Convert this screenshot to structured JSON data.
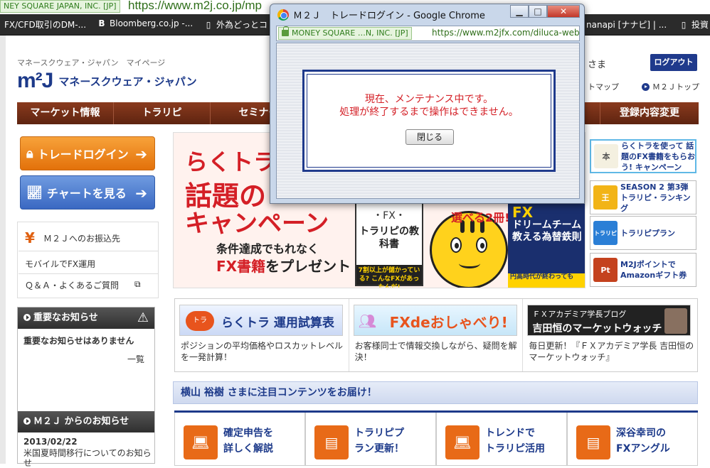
{
  "browser": {
    "ssl_badge": "NEY SQUARE JAPAN, INC. [JP]",
    "url": "https://www.m2j.co.jp/mp",
    "bookmarks": [
      {
        "icon": "",
        "label": "FX/CFD取引のDM-..."
      },
      {
        "icon": "B",
        "label": "Bloomberg.co.jp -..."
      },
      {
        "icon": "",
        "label": "外為どっとコ"
      },
      {
        "icon": "",
        "label": "nanapi [ナナピ] | ..."
      },
      {
        "icon": "",
        "label": "投資"
      }
    ]
  },
  "site": {
    "subtitle": "マネースクウェア・ジャパン　マイページ",
    "logo_mark": "m²J",
    "logo_name": "マネースクウェア・ジャパン",
    "user_suffix": "さま",
    "logout_label": "ログアウト",
    "sitemap_label": "トマップ",
    "top_label": "Ｍ２Ｊトップ",
    "nav": [
      "マーケット情報",
      "トラリピ",
      "セミナー",
      "登録内容変更"
    ]
  },
  "left": {
    "login_button": "トレードログイン",
    "chart_button": "チャートを見る",
    "links": [
      "Ｍ２Ｊへのお振込先",
      "モバイルでFX運用",
      "Ｑ＆Ａ・よくあるご質問"
    ],
    "important_heading": "重要なお知らせ",
    "important_text": "重要なお知らせはありません",
    "important_more": "一覧",
    "m2j_heading": "Ｍ２Ｊ からのお知らせ",
    "m2j_date": "2013/02/22",
    "m2j_text": "米国夏時間移行についてのお知らせ"
  },
  "banner": {
    "line1": "らくトラを",
    "line2": "話題の",
    "line3": "キャンペーン",
    "sub1": "条件達成でもれなく",
    "sub2_accent": "FX書籍",
    "sub2_rest": "をプレゼント",
    "select_text": "選べる2冊!",
    "book1_label": "・FX・",
    "book1_title": "トラリピの教科書",
    "book1_band": "7割以上が儲かっている? こんなFXがあったんだ!",
    "book2_fx": "FX",
    "book2_title": "ドリームチーム教える為替鉄則",
    "book2_band": "円高時代が終わっても"
  },
  "right_boxes": [
    {
      "icon": "本",
      "text": "らくトラを使って 話題のFX書籍をもらおう! キャンペーン",
      "color": "#ffffff"
    },
    {
      "icon": "王",
      "text": "SEASON 2 第3弾 トラリピ・ランキング",
      "color": "#f2b417"
    },
    {
      "icon": "トラリピ",
      "text": "トラリピプラン",
      "color": "#2b7fd6"
    },
    {
      "icon": "Pt",
      "text": "M2Jポイントで Amazonギフト券",
      "color": "#c4421e"
    }
  ],
  "features": [
    {
      "banner": "らくトラ 運用試算表",
      "text": "ポジションの平均価格やロスカットレベルを一発計算！"
    },
    {
      "banner": "FXdeおしゃべり!",
      "text": "お客様同士で情報交換しながら、疑問を解決！"
    },
    {
      "banner_top": "ＦＸアカデミア学長ブログ",
      "banner": "吉田恒のマーケットウォッチ",
      "text": "毎日更新！『ＦＸアカデミア学長 吉田恒のマーケットウォッチ』"
    }
  ],
  "attention": "横山 裕樹 さまに注目コンテンツをお届け！",
  "cards": [
    {
      "line1": "確定申告を",
      "line2": "詳しく解説"
    },
    {
      "line1": "トラリピプ",
      "line2": "ラン更新！"
    },
    {
      "line1": "トレンドで",
      "line2": "トラリピ活用"
    },
    {
      "line1": "深谷幸司の",
      "line2": "FXアングル"
    }
  ],
  "popup": {
    "title": "Ｍ２Ｊ　トレードログイン - Google Chrome",
    "ssl_badge": "MONEY SQUARE …N, INC. [JP]",
    "url": "https://www.m2jfx.com/diluca-web",
    "message1": "現在、メンテナンス中です。",
    "message2": "処理が終了するまで操作はできません。",
    "close_label": "閉じる",
    "min_label": "▁",
    "max_label": "□",
    "close_x": "✕"
  }
}
